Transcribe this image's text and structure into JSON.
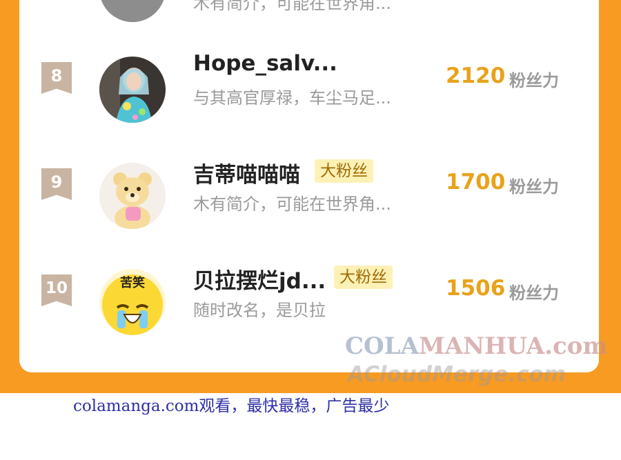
{
  "previous_row": {
    "bio": "木有简介，可能在世界角..."
  },
  "rows": [
    {
      "rank": "8",
      "name": "Hope_salv...",
      "badge": "",
      "bio": "与其高官厚禄，车尘马足...",
      "score": "2120",
      "unit": "粉丝力",
      "avatar_icon": "girl-photo-avatar"
    },
    {
      "rank": "9",
      "name": "吉蒂喵喵喵",
      "badge": "大粉丝",
      "bio": "木有简介，可能在世界角...",
      "score": "1700",
      "unit": "粉丝力",
      "avatar_icon": "teddy-bear-avatar"
    },
    {
      "rank": "10",
      "name": "贝拉摆烂jd...",
      "badge": "大粉丝",
      "bio": "随时改名，是贝拉",
      "score": "1506",
      "unit": "粉丝力",
      "avatar_icon": "crying-emoji-avatar",
      "avatar_text": "苦笑"
    }
  ],
  "watermark": {
    "line1_a": "COLA",
    "line1_b": "MANHUA",
    "line1_c": ".com",
    "line2": "ACloudMerge.com"
  },
  "footer_text": "colamanga.com观看，最快最稳，广告最少",
  "colors": {
    "frame": "#f89b22",
    "score": "#e9a21b",
    "badge_bg": "#fdf1b6",
    "rank_bg": "#c9b4a2"
  }
}
